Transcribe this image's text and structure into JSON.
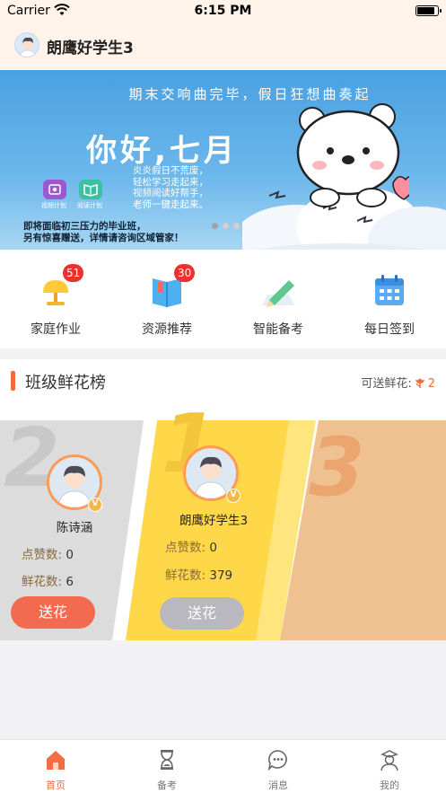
{
  "status_bar": {
    "carrier": "Carrier",
    "time": "6:15 PM",
    "battery_level": 0.9
  },
  "header": {
    "user_name": "朗鹰好学生3"
  },
  "banner": {
    "top_text": "期末交响曲完毕，假日狂想曲奏起",
    "title": "你好,七月",
    "lines": [
      "炎炎假日不荒废，",
      "轻松学习走起来，",
      "视频阅读好帮手，",
      "老师一键走起来。"
    ],
    "note_lines": [
      "即将面临初三压力的毕业班，",
      "另有惊喜赠送，详情请咨询区域管家！"
    ],
    "mini_icons": [
      {
        "label": "视频计划",
        "icon": "video-plan-icon",
        "color": "#9b59d0"
      },
      {
        "label": "阅读计划",
        "icon": "reading-plan-icon",
        "color": "#3cc0a0"
      }
    ],
    "pager": {
      "count": 3,
      "active_index": 0
    }
  },
  "quick_nav": [
    {
      "label": "家庭作业",
      "icon": "lamp-icon",
      "badge": "51"
    },
    {
      "label": "资源推荐",
      "icon": "book-icon",
      "badge": "30"
    },
    {
      "label": "智能备考",
      "icon": "pencil-icon",
      "badge": ""
    },
    {
      "label": "每日签到",
      "icon": "calendar-icon",
      "badge": ""
    }
  ],
  "board": {
    "title": "班级鲜花榜",
    "can_send_label": "可送鲜花:",
    "can_send_count": "2",
    "podium": [
      {
        "rank": "2",
        "name": "陈诗涵",
        "likes_label": "点赞数:",
        "likes": "0",
        "flowers_label": "鲜花数:",
        "flowers": "6",
        "button": "送花",
        "button_enabled": true
      },
      {
        "rank": "1",
        "name": "朗鹰好学生3",
        "likes_label": "点赞数:",
        "likes": "0",
        "flowers_label": "鲜花数:",
        "flowers": "379",
        "button": "送花",
        "button_enabled": false
      },
      {
        "rank": "3"
      }
    ]
  },
  "colors": {
    "accent": "#f06c3a",
    "gold": "#ffd84a",
    "peach": "#f0c190",
    "silver": "#dcdcdc",
    "disabled": "#b8b8be"
  },
  "tabbar": [
    {
      "label": "首页",
      "icon": "home-icon",
      "active": true
    },
    {
      "label": "备考",
      "icon": "hourglass-icon",
      "active": false
    },
    {
      "label": "消息",
      "icon": "chat-bubble-icon",
      "active": false
    },
    {
      "label": "我的",
      "icon": "profile-icon",
      "active": false
    }
  ]
}
